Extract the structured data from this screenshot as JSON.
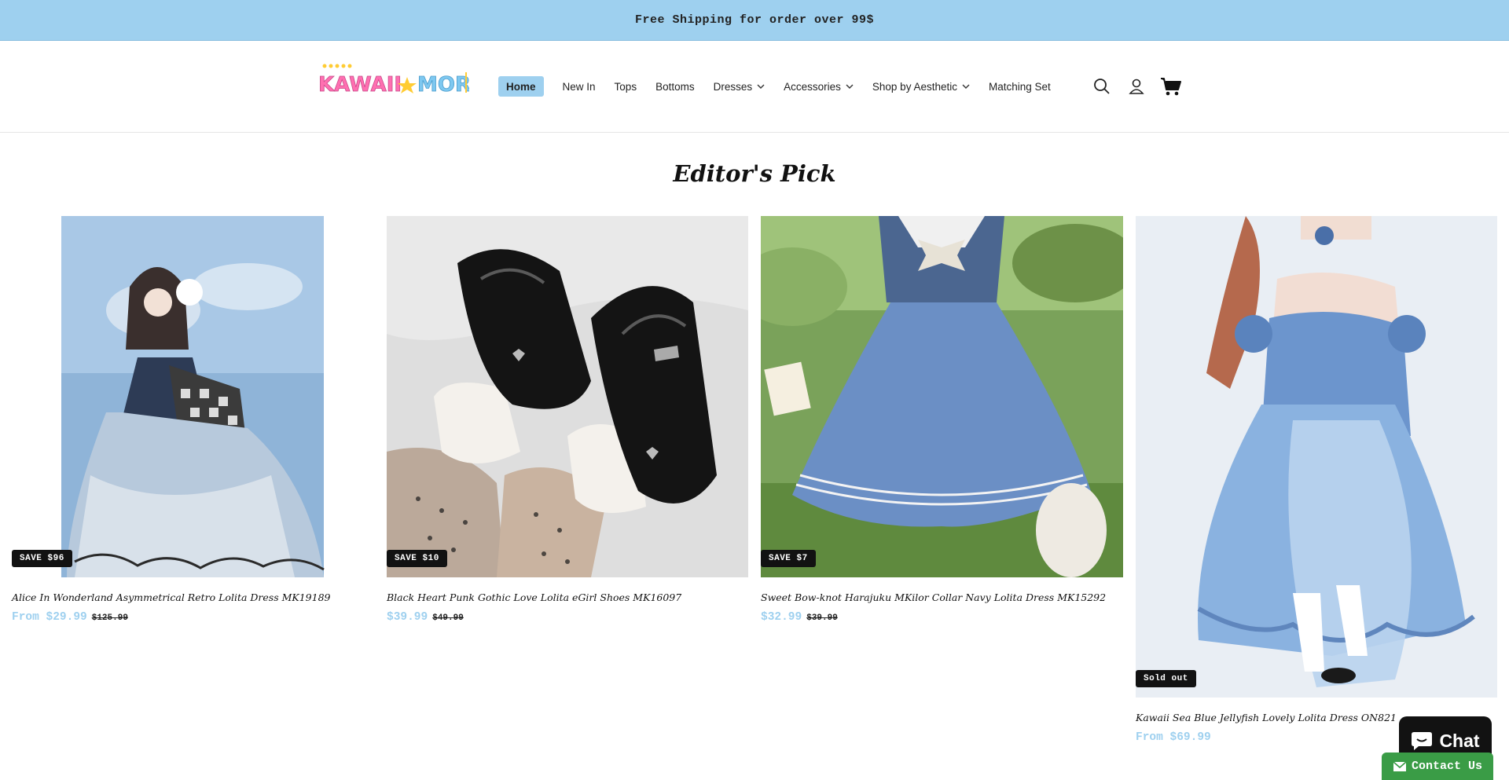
{
  "announcement": "Free Shipping for order over 99$",
  "brand": {
    "name": "KAWAII MORI",
    "colors": [
      "#ff6fb1",
      "#ffcc33",
      "#7ec8f0"
    ]
  },
  "nav": {
    "items": [
      {
        "label": "Home",
        "active": true,
        "dropdown": false
      },
      {
        "label": "New In",
        "dropdown": false
      },
      {
        "label": "Tops",
        "dropdown": false
      },
      {
        "label": "Bottoms",
        "dropdown": false
      },
      {
        "label": "Dresses",
        "dropdown": true
      },
      {
        "label": "Accessories",
        "dropdown": true
      },
      {
        "label": "Shop by Aesthetic",
        "dropdown": true
      },
      {
        "label": "Matching Set",
        "dropdown": false
      }
    ],
    "icons": [
      "search-icon",
      "account-icon",
      "cart-icon"
    ]
  },
  "section": {
    "title": "Editor's Pick"
  },
  "products": [
    {
      "badge": "SAVE $96",
      "title": "Alice In Wonderland Asymmetrical Retro Lolita Dress MK19189",
      "price": "From $29.99",
      "compare": "$125.99"
    },
    {
      "badge": "SAVE $10",
      "title": "Black Heart Punk Gothic Love Lolita eGirl Shoes MK16097",
      "price": "$39.99",
      "compare": "$49.99"
    },
    {
      "badge": "SAVE $7",
      "title": "Sweet Bow-knot Harajuku MKilor Collar Navy Lolita Dress MK15292",
      "price": "$32.99",
      "compare": "$39.99"
    },
    {
      "badge": "Sold out",
      "title": "Kawaii Sea Blue Jellyfish Lovely Lolita Dress ON821",
      "price": "From $69.99",
      "compare": ""
    }
  ],
  "chat": {
    "label": "Chat"
  },
  "contact": {
    "label": "Contact Us"
  },
  "colors": {
    "accent": "#9ed0ef",
    "badge_bg": "#121212",
    "contact_green": "#3a9c46"
  }
}
